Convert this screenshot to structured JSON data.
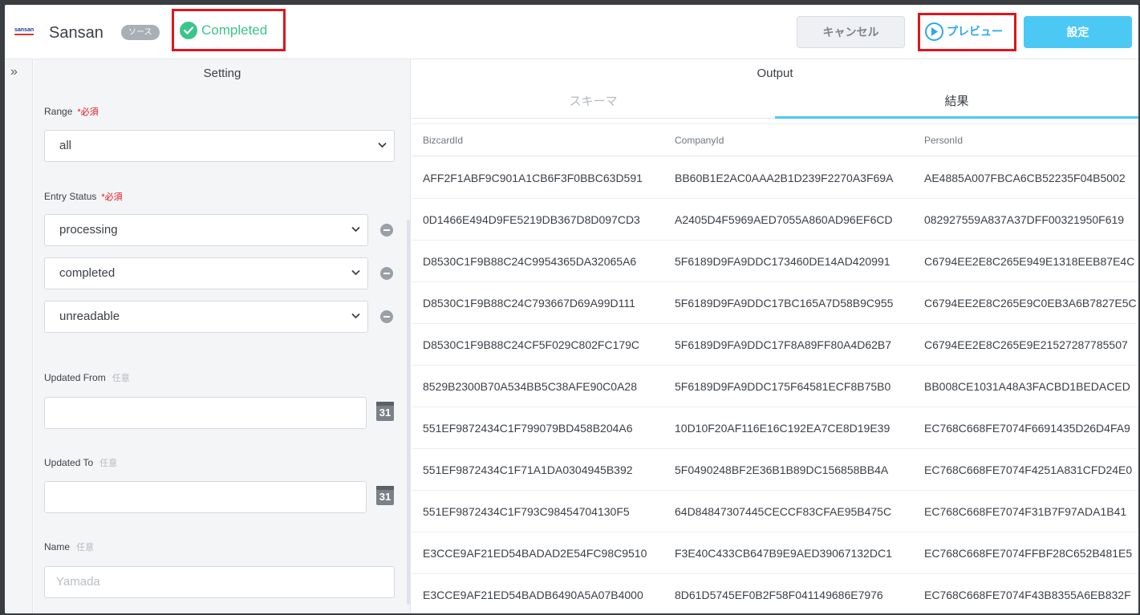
{
  "header": {
    "logo_text": "sansan",
    "title": "Sansan",
    "source_badge": "ソース",
    "status": "Completed",
    "cancel_label": "キャンセル",
    "preview_label": "プレビュー",
    "set_label": "設定",
    "colors": {
      "success": "#3bc58b",
      "accent": "#4cc8f4",
      "highlight": "#e0141c"
    }
  },
  "rail": {
    "expand_icon": "double-chevron-right-icon",
    "glyph": "»"
  },
  "setting": {
    "title": "Setting",
    "range": {
      "label": "Range",
      "required": "*必須",
      "value": "all"
    },
    "entry_status": {
      "label": "Entry Status",
      "required": "*必須",
      "values": [
        "processing",
        "completed",
        "unreadable"
      ]
    },
    "updated_from": {
      "label": "Updated From",
      "optional": "任意",
      "value": "",
      "calendar": "31"
    },
    "updated_to": {
      "label": "Updated To",
      "optional": "任意",
      "value": "",
      "calendar": "31"
    },
    "name": {
      "label": "Name",
      "optional": "任意",
      "placeholder": "Yamada"
    }
  },
  "output": {
    "title": "Output",
    "tabs": [
      {
        "label": "スキーマ",
        "active": false
      },
      {
        "label": "結果",
        "active": true
      }
    ],
    "columns": [
      "BizcardId",
      "CompanyId",
      "PersonId"
    ],
    "rows": [
      [
        "AFF2F1ABF9C901A1CB6F3F0BBC63D591",
        "BB60B1E2AC0AAA2B1D239F2270A3F69A",
        "AE4885A007FBCA6CB52235F04B5002"
      ],
      [
        "0D1466E494D9FE5219DB367D8D097CD3",
        "A2405D4F5969AED7055A860AD96EF6CD",
        "082927559A837A37DFF00321950F619"
      ],
      [
        "D8530C1F9B88C24C9954365DA32065A6",
        "5F6189D9FA9DDC173460DE14AD420991",
        "C6794EE2E8C265E949E1318EEB87E4C"
      ],
      [
        "D8530C1F9B88C24C793667D69A99D111",
        "5F6189D9FA9DDC17BC165A7D58B9C955",
        "C6794EE2E8C265E9C0EB3A6B7827E5C"
      ],
      [
        "D8530C1F9B88C24CF5F029C802FC179C",
        "5F6189D9FA9DDC17F8A89FF80A4D62B7",
        "C6794EE2E8C265E9E21527287785507"
      ],
      [
        "8529B2300B70A534BB5C38AFE90C0A28",
        "5F6189D9FA9DDC175F64581ECF8B75B0",
        "BB008CE1031A48A3FACBD1BEDACED"
      ],
      [
        "551EF9872434C1F799079BD458B204A6",
        "10D10F20AF116E16C192EA7CE8D19E39",
        "EC768C668FE7074F6691435D26D4FA9"
      ],
      [
        "551EF9872434C1F71A1DA0304945B392",
        "5F0490248BF2E36B1B89DC156858BB4A",
        "EC768C668FE7074F4251A831CFD24E0"
      ],
      [
        "551EF9872434C1F793C98454704130F5",
        "64D84847307445CECCF83CFAE95B475C",
        "EC768C668FE7074F31B7F97ADA1B41"
      ],
      [
        "E3CCE9AF21ED54BADAD2E54FC98C9510",
        "F3E40C433CB647B9E9AED39067132DC1",
        "EC768C668FE7074FFBF28C652B481E5"
      ],
      [
        "E3CCE9AF21ED54BADB6490A5A07B4000",
        "8D61D5745EF0B2F58F041149686E7976",
        "EC768C668FE7074F43B8355A6EB832F"
      ]
    ]
  }
}
